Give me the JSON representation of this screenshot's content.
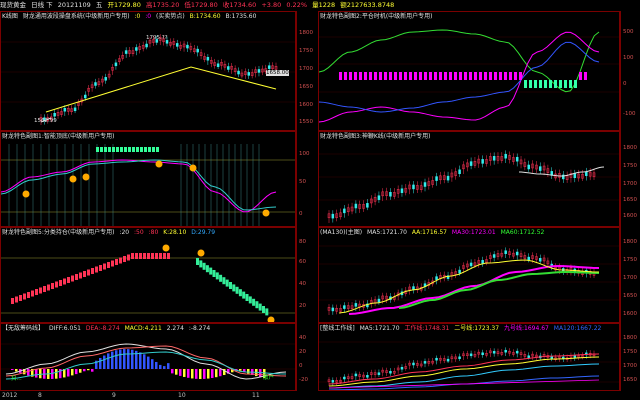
{
  "topbar": {
    "symbol": "现货黄金",
    "period": "日线 下",
    "date": "20121109",
    "weekday": "五",
    "open": "开1729.80",
    "high": "高1735.20",
    "low": "低1729.80",
    "close": "收1734.60",
    "change": "+3.80",
    "pct": "0.22%",
    "vol": "量1228",
    "amount": "额2127633.8748"
  },
  "panels": {
    "p1": {
      "title": "K线图",
      "name": "财龙通用波段操盘系统(中级新用户专用)",
      "v1": ":0",
      "v2": ":0",
      "v3": "(买卖势点)",
      "v4": "B:1734.60",
      "v5": "B:1735.60",
      "ticks": [
        "1800",
        "1750",
        "1700",
        "1650",
        "1600",
        "1550"
      ],
      "label_high": "1795.??",
      "label_low": "1562.99",
      "label_mid": "1658.00"
    },
    "p2": {
      "title": "财龙特色副图2:平仓时机(中级新用户专用)",
      "ticks": [
        "500",
        "100",
        "0",
        "-100"
      ]
    },
    "p3": {
      "title": "财龙特色副图1:智能顶底(中级新用户专用)",
      "ticks": [
        "100",
        "50",
        "0"
      ]
    },
    "p4": {
      "title": "财龙特色副图3:神鞭K线(中级新用户专用)",
      "ticks": [
        "1800",
        "1750",
        "1700",
        "1650",
        "1600"
      ]
    },
    "p5": {
      "title": "财龙特色副图5:分类持仓(中级新用户专用)",
      "v1": ":20",
      "v2": ":50",
      "v3": ":80",
      "v4": "K:28.10",
      "v5": "D:29.79",
      "ticks": [
        "80",
        "60",
        "40",
        "20"
      ]
    },
    "p6": {
      "title": "(MA130)(主图)",
      "ma5": "MA5:1721.70",
      "aa": "AA:1716.57",
      "ma30": "MA30:1723.01",
      "ma60": "MA60:1712.52",
      "ticks": [
        "1800",
        "1750",
        "1700",
        "1650",
        "1600"
      ]
    },
    "p7": {
      "title": "【无敌筹码线】",
      "diff": "DIFF:6.051",
      "dea": "DEA:-8.274",
      "macd": "MACD:4.211",
      "v4": "2.274",
      "v5": ":-8.274",
      "ticks": [
        "40",
        "20",
        "0",
        "-20"
      ],
      "label_left": "扫...",
      "label_right": "散户"
    },
    "p8": {
      "title": "[整线工作线]",
      "ma5": "MA5:1721.70",
      "line1": "工作线:1748.31",
      "line2": "二号线:1723.37",
      "line3": "九号线:1694.67",
      "ma120": "MA120:1667.22",
      "ticks": [
        "1800",
        "1750",
        "1700",
        "1650"
      ]
    }
  },
  "dates": [
    "2012",
    "8",
    "9",
    "10",
    "11"
  ],
  "colors": {
    "border": "#7a0000",
    "up": "#ff3355",
    "down": "#33eeee",
    "yellow": "#ffff33",
    "magenta": "#ff00ff",
    "green": "#33dd33",
    "white": "#e0e0e0"
  }
}
